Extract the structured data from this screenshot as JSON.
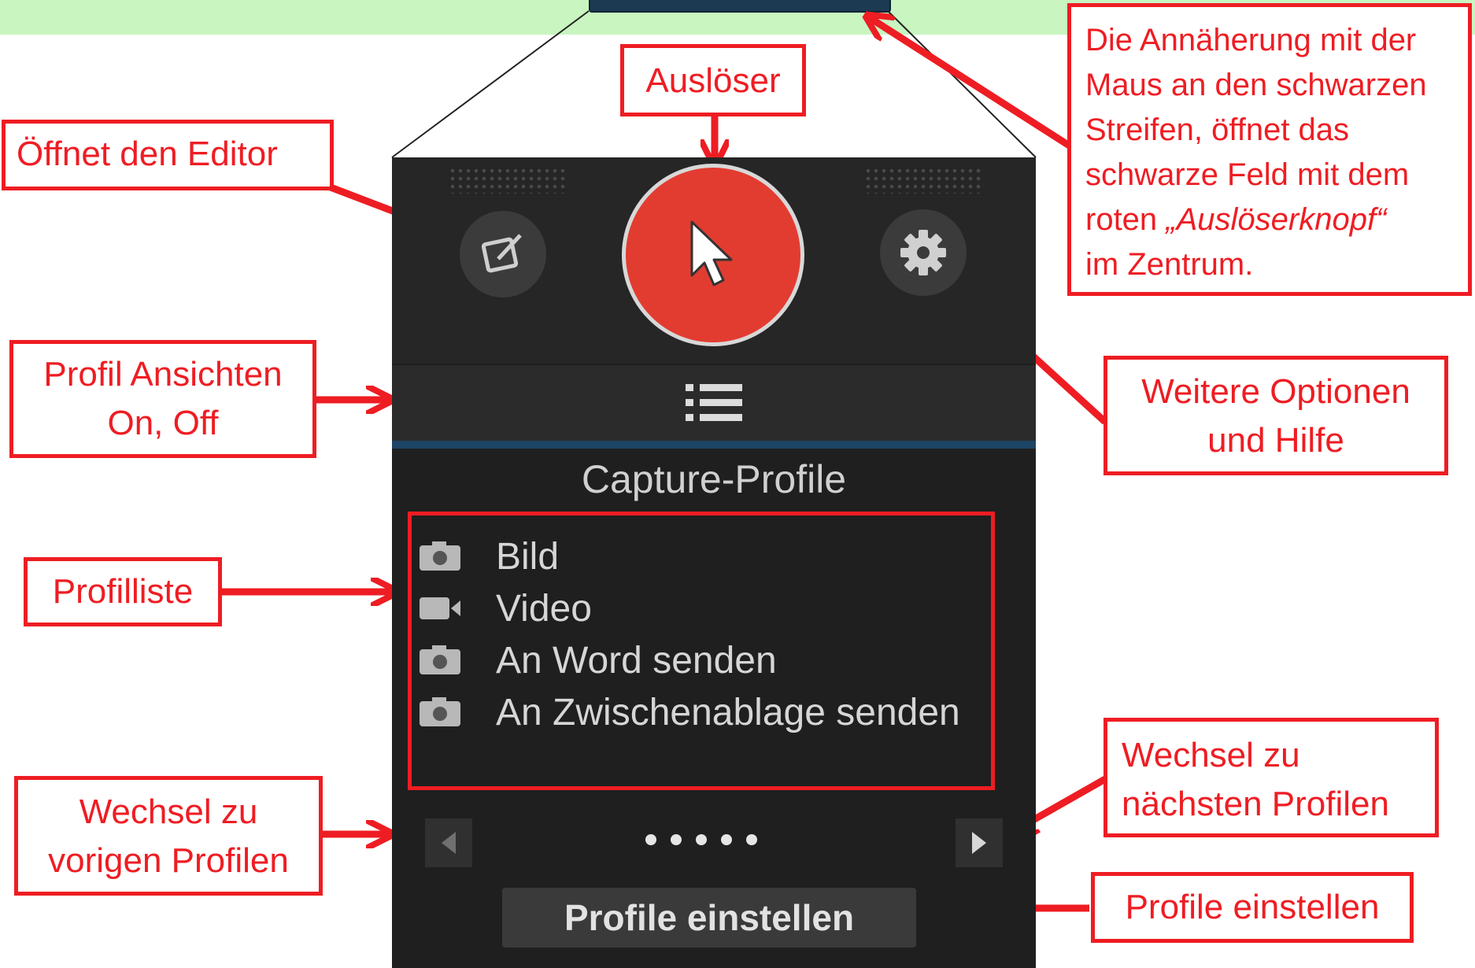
{
  "toolbar": {
    "panel_title": "Capture-Profile",
    "profiles": [
      {
        "icon": "camera-icon",
        "label": "Bild"
      },
      {
        "icon": "video-icon",
        "label": "Video"
      },
      {
        "icon": "camera-icon",
        "label": "An Word senden"
      },
      {
        "icon": "camera-icon",
        "label": "An Zwischenablage senden"
      }
    ],
    "page_count": 5,
    "setup_button_label": "Profile einstellen"
  },
  "callouts": {
    "trigger": "Auslöser",
    "editor": "Öffnet den Editor",
    "view_toggle_line1": "Profil Ansichten",
    "view_toggle_line2": "On, Off",
    "hover_line1": "Die Annäherung mit der",
    "hover_line2": "Maus an den schwarzen",
    "hover_line3": "Streifen, öffnet das",
    "hover_line4": "schwarze Feld mit dem",
    "hover_line5_prefix": "roten ",
    "hover_line5_italic": "„Auslöserknopf“",
    "hover_line6": "im Zentrum.",
    "options_line1": "Weitere Optionen",
    "options_line2": "und Hilfe",
    "profile_list": "Profilliste",
    "next_line1": "Wechsel zu",
    "next_line2": "nächsten Profilen",
    "prev_line1": "Wechsel zu",
    "prev_line2": "vorigen Profilen",
    "setup": "Profile einstellen"
  },
  "colors": {
    "annotation_red": "#ee1d23",
    "trigger_red": "#e23c31",
    "panel_dark": "#1f1f1f",
    "green_bar": "#c8f5c0"
  }
}
